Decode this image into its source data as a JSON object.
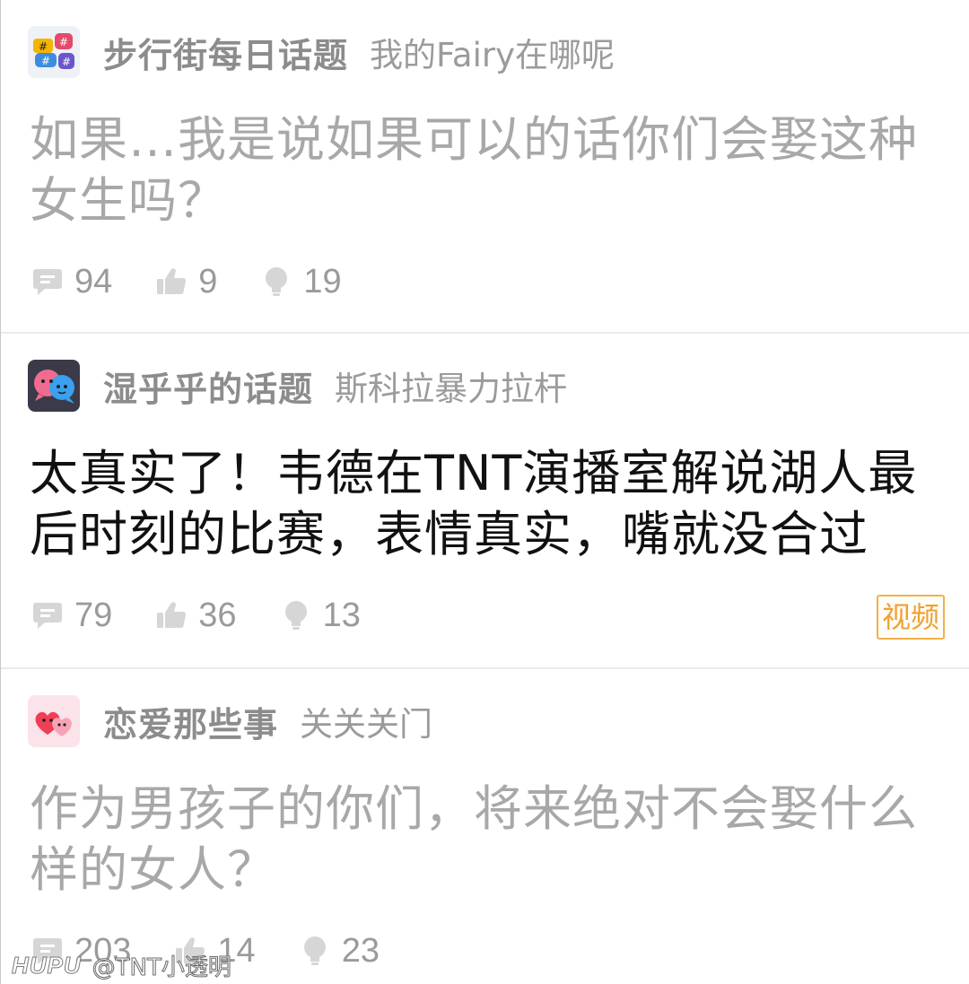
{
  "posts": [
    {
      "forum": "步行街每日话题",
      "author": "我的Fairy在哪呢",
      "title": "如果…我是说如果可以的话你们会娶这种女生吗？",
      "read": true,
      "replies": "94",
      "likes": "9",
      "lights": "19",
      "avatar_icon": "hashtag-bubbles-icon"
    },
    {
      "forum": "湿乎乎的话题",
      "author": "斯科拉暴力拉杆",
      "title": "太真实了！韦德在TNT演播室解说湖人最后时刻的比赛，表情真实，嘴就没合过",
      "read": false,
      "replies": "79",
      "likes": "36",
      "lights": "13",
      "badge": "视频",
      "avatar_icon": "chat-faces-icon"
    },
    {
      "forum": "恋爱那些事",
      "author": "关关关门",
      "title": "作为男孩子的你们，将来绝对不会娶什么样的女人？",
      "read": true,
      "replies": "203",
      "likes": "14",
      "lights": "23",
      "avatar_icon": "heart-faces-icon"
    }
  ],
  "watermark": {
    "logo": "HUPU",
    "user": "@TNT小透明"
  },
  "colors": {
    "read_title": "#a8a8a8",
    "unread_title": "#111111",
    "meta_gray": "#9a9a9a",
    "badge_orange": "#f0a030"
  }
}
